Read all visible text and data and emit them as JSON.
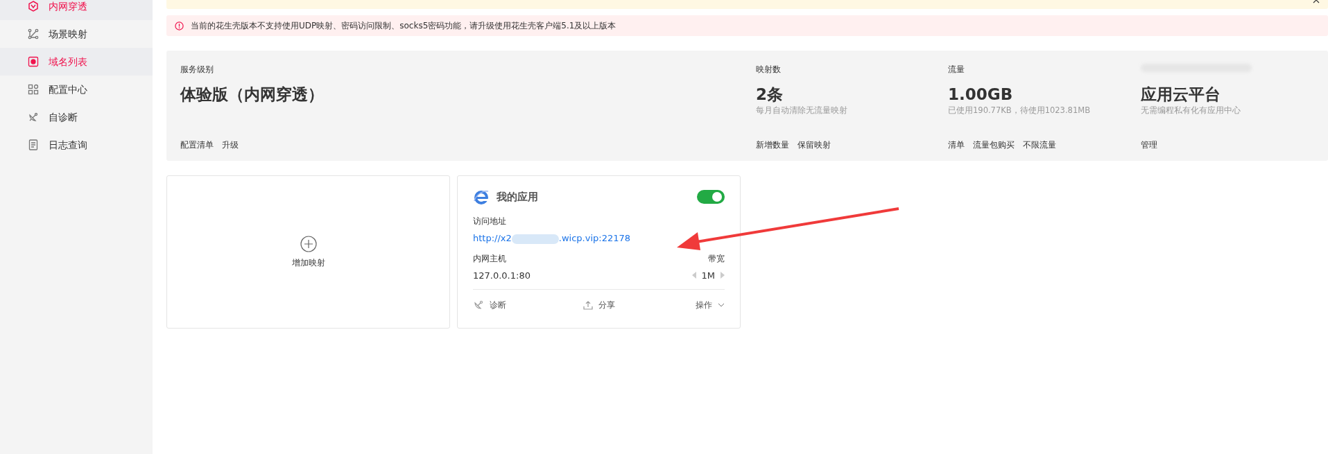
{
  "sidebar": {
    "items": [
      {
        "label": "内网穿透",
        "selected": true
      },
      {
        "label": "场景映射",
        "selected": false
      },
      {
        "label": "域名列表",
        "selected": true
      },
      {
        "label": "配置中心",
        "selected": false
      },
      {
        "label": "自诊断",
        "selected": false
      },
      {
        "label": "日志查询",
        "selected": false
      }
    ]
  },
  "notices": [
    {
      "kind": "info"
    },
    {
      "kind": "error",
      "text": "当前的花生壳版本不支持使用UDP映射、密码访问限制、socks5密码功能，请升级使用花生壳客户端5.1及以上版本"
    }
  ],
  "summary": [
    {
      "label": "服务级别",
      "value": "体验版（内网穿透）",
      "actions": [
        "配置清单",
        "升级"
      ]
    },
    {
      "label": "映射数",
      "value": "2条",
      "note": "每月自动清除无流量映射",
      "actions": [
        "新增数量",
        "保留映射"
      ]
    },
    {
      "label": "流量",
      "value": "1.00GB",
      "note": "已使用190.77KB，待使用1023.81MB",
      "actions": [
        "清单",
        "流量包购买",
        "不限流量"
      ]
    },
    {
      "label_blurred": true,
      "value": "应用云平台",
      "note": "无需编程私有化有应用中心",
      "actions": [
        "管理"
      ]
    }
  ],
  "add_card": {
    "label": "增加映射"
  },
  "apps": [
    {
      "name": "我的应用",
      "on": true,
      "address_label": "访问地址",
      "address_start": "http://x2",
      "address_end": ".wicp.vip:22178",
      "host_label": "内网主机",
      "host": "127.0.0.1:80",
      "bandwidth_label": "带宽",
      "bandwidth": "1M",
      "actions": [
        "诊断",
        "分享",
        "操作"
      ]
    }
  ]
}
